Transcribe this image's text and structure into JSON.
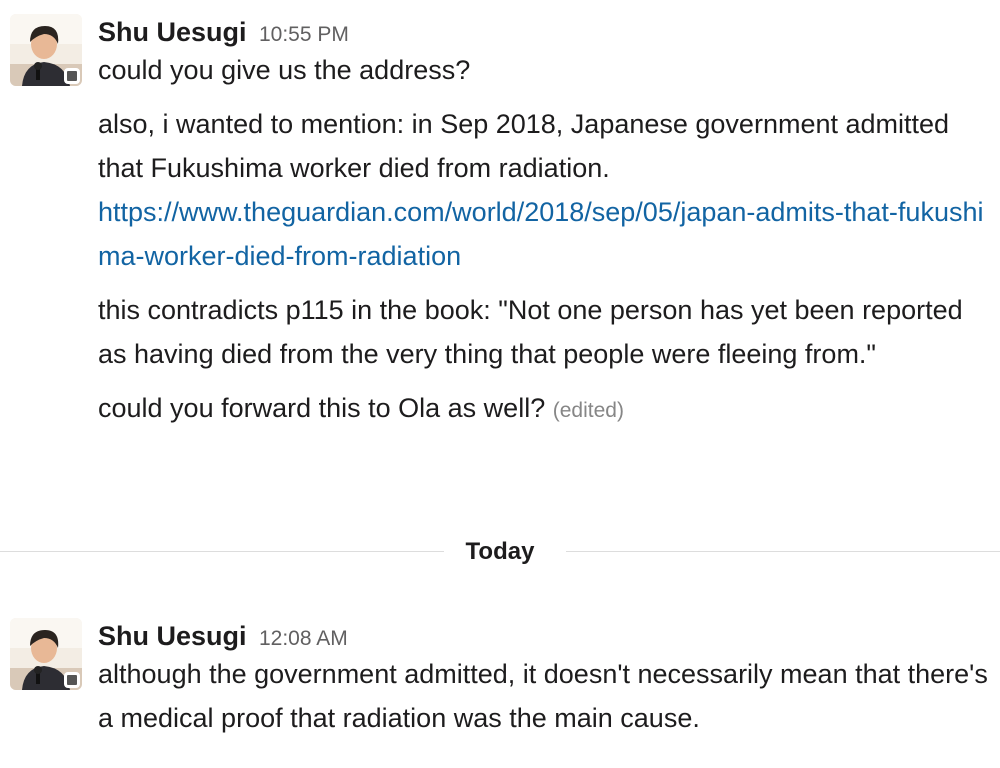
{
  "colors": {
    "text": "#1d1c1d",
    "timestamp": "#616061",
    "link": "#1264a3",
    "edited": "#868686",
    "divider_line": "#dddddd",
    "presence_away": "#555555"
  },
  "messages": [
    {
      "sender": "Shu Uesugi",
      "time": "10:55 PM",
      "avatar_icon": "user-avatar-photo",
      "lines": [
        "could you give us the address?",
        "also, i wanted to mention: in Sep 2018, Japanese government admitted that Fukushima worker died from radiation.",
        "this contradicts p115 in the book: \"Not one person has yet been reported as having died from the very thing that people were fleeing from.\"",
        "could you forward this to Ola as well?"
      ],
      "link": "https://www.theguardian.com/world/2018/sep/05/japan-admits-that-fukushima-worker-died-from-radiation",
      "edited_label": "(edited)"
    },
    {
      "sender": "Shu Uesugi",
      "time": "12:08 AM",
      "avatar_icon": "user-avatar-photo",
      "lines": [
        "although the government admitted, it doesn't necessarily mean that there's a medical proof that radiation was the main cause."
      ]
    }
  ],
  "divider": {
    "label": "Today"
  }
}
